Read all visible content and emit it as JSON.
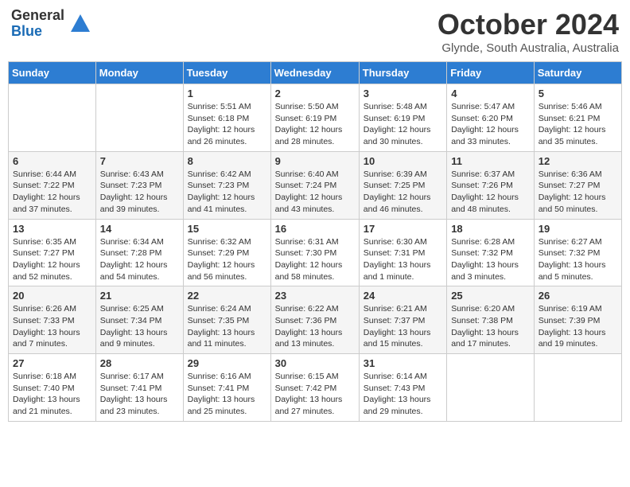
{
  "header": {
    "logo_general": "General",
    "logo_blue": "Blue",
    "month": "October 2024",
    "location": "Glynde, South Australia, Australia"
  },
  "days_of_week": [
    "Sunday",
    "Monday",
    "Tuesday",
    "Wednesday",
    "Thursday",
    "Friday",
    "Saturday"
  ],
  "weeks": [
    [
      {
        "day": "",
        "info": ""
      },
      {
        "day": "",
        "info": ""
      },
      {
        "day": "1",
        "info": "Sunrise: 5:51 AM\nSunset: 6:18 PM\nDaylight: 12 hours\nand 26 minutes."
      },
      {
        "day": "2",
        "info": "Sunrise: 5:50 AM\nSunset: 6:19 PM\nDaylight: 12 hours\nand 28 minutes."
      },
      {
        "day": "3",
        "info": "Sunrise: 5:48 AM\nSunset: 6:19 PM\nDaylight: 12 hours\nand 30 minutes."
      },
      {
        "day": "4",
        "info": "Sunrise: 5:47 AM\nSunset: 6:20 PM\nDaylight: 12 hours\nand 33 minutes."
      },
      {
        "day": "5",
        "info": "Sunrise: 5:46 AM\nSunset: 6:21 PM\nDaylight: 12 hours\nand 35 minutes."
      }
    ],
    [
      {
        "day": "6",
        "info": "Sunrise: 6:44 AM\nSunset: 7:22 PM\nDaylight: 12 hours\nand 37 minutes."
      },
      {
        "day": "7",
        "info": "Sunrise: 6:43 AM\nSunset: 7:23 PM\nDaylight: 12 hours\nand 39 minutes."
      },
      {
        "day": "8",
        "info": "Sunrise: 6:42 AM\nSunset: 7:23 PM\nDaylight: 12 hours\nand 41 minutes."
      },
      {
        "day": "9",
        "info": "Sunrise: 6:40 AM\nSunset: 7:24 PM\nDaylight: 12 hours\nand 43 minutes."
      },
      {
        "day": "10",
        "info": "Sunrise: 6:39 AM\nSunset: 7:25 PM\nDaylight: 12 hours\nand 46 minutes."
      },
      {
        "day": "11",
        "info": "Sunrise: 6:37 AM\nSunset: 7:26 PM\nDaylight: 12 hours\nand 48 minutes."
      },
      {
        "day": "12",
        "info": "Sunrise: 6:36 AM\nSunset: 7:27 PM\nDaylight: 12 hours\nand 50 minutes."
      }
    ],
    [
      {
        "day": "13",
        "info": "Sunrise: 6:35 AM\nSunset: 7:27 PM\nDaylight: 12 hours\nand 52 minutes."
      },
      {
        "day": "14",
        "info": "Sunrise: 6:34 AM\nSunset: 7:28 PM\nDaylight: 12 hours\nand 54 minutes."
      },
      {
        "day": "15",
        "info": "Sunrise: 6:32 AM\nSunset: 7:29 PM\nDaylight: 12 hours\nand 56 minutes."
      },
      {
        "day": "16",
        "info": "Sunrise: 6:31 AM\nSunset: 7:30 PM\nDaylight: 12 hours\nand 58 minutes."
      },
      {
        "day": "17",
        "info": "Sunrise: 6:30 AM\nSunset: 7:31 PM\nDaylight: 13 hours\nand 1 minute."
      },
      {
        "day": "18",
        "info": "Sunrise: 6:28 AM\nSunset: 7:32 PM\nDaylight: 13 hours\nand 3 minutes."
      },
      {
        "day": "19",
        "info": "Sunrise: 6:27 AM\nSunset: 7:32 PM\nDaylight: 13 hours\nand 5 minutes."
      }
    ],
    [
      {
        "day": "20",
        "info": "Sunrise: 6:26 AM\nSunset: 7:33 PM\nDaylight: 13 hours\nand 7 minutes."
      },
      {
        "day": "21",
        "info": "Sunrise: 6:25 AM\nSunset: 7:34 PM\nDaylight: 13 hours\nand 9 minutes."
      },
      {
        "day": "22",
        "info": "Sunrise: 6:24 AM\nSunset: 7:35 PM\nDaylight: 13 hours\nand 11 minutes."
      },
      {
        "day": "23",
        "info": "Sunrise: 6:22 AM\nSunset: 7:36 PM\nDaylight: 13 hours\nand 13 minutes."
      },
      {
        "day": "24",
        "info": "Sunrise: 6:21 AM\nSunset: 7:37 PM\nDaylight: 13 hours\nand 15 minutes."
      },
      {
        "day": "25",
        "info": "Sunrise: 6:20 AM\nSunset: 7:38 PM\nDaylight: 13 hours\nand 17 minutes."
      },
      {
        "day": "26",
        "info": "Sunrise: 6:19 AM\nSunset: 7:39 PM\nDaylight: 13 hours\nand 19 minutes."
      }
    ],
    [
      {
        "day": "27",
        "info": "Sunrise: 6:18 AM\nSunset: 7:40 PM\nDaylight: 13 hours\nand 21 minutes."
      },
      {
        "day": "28",
        "info": "Sunrise: 6:17 AM\nSunset: 7:41 PM\nDaylight: 13 hours\nand 23 minutes."
      },
      {
        "day": "29",
        "info": "Sunrise: 6:16 AM\nSunset: 7:41 PM\nDaylight: 13 hours\nand 25 minutes."
      },
      {
        "day": "30",
        "info": "Sunrise: 6:15 AM\nSunset: 7:42 PM\nDaylight: 13 hours\nand 27 minutes."
      },
      {
        "day": "31",
        "info": "Sunrise: 6:14 AM\nSunset: 7:43 PM\nDaylight: 13 hours\nand 29 minutes."
      },
      {
        "day": "",
        "info": ""
      },
      {
        "day": "",
        "info": ""
      }
    ]
  ]
}
